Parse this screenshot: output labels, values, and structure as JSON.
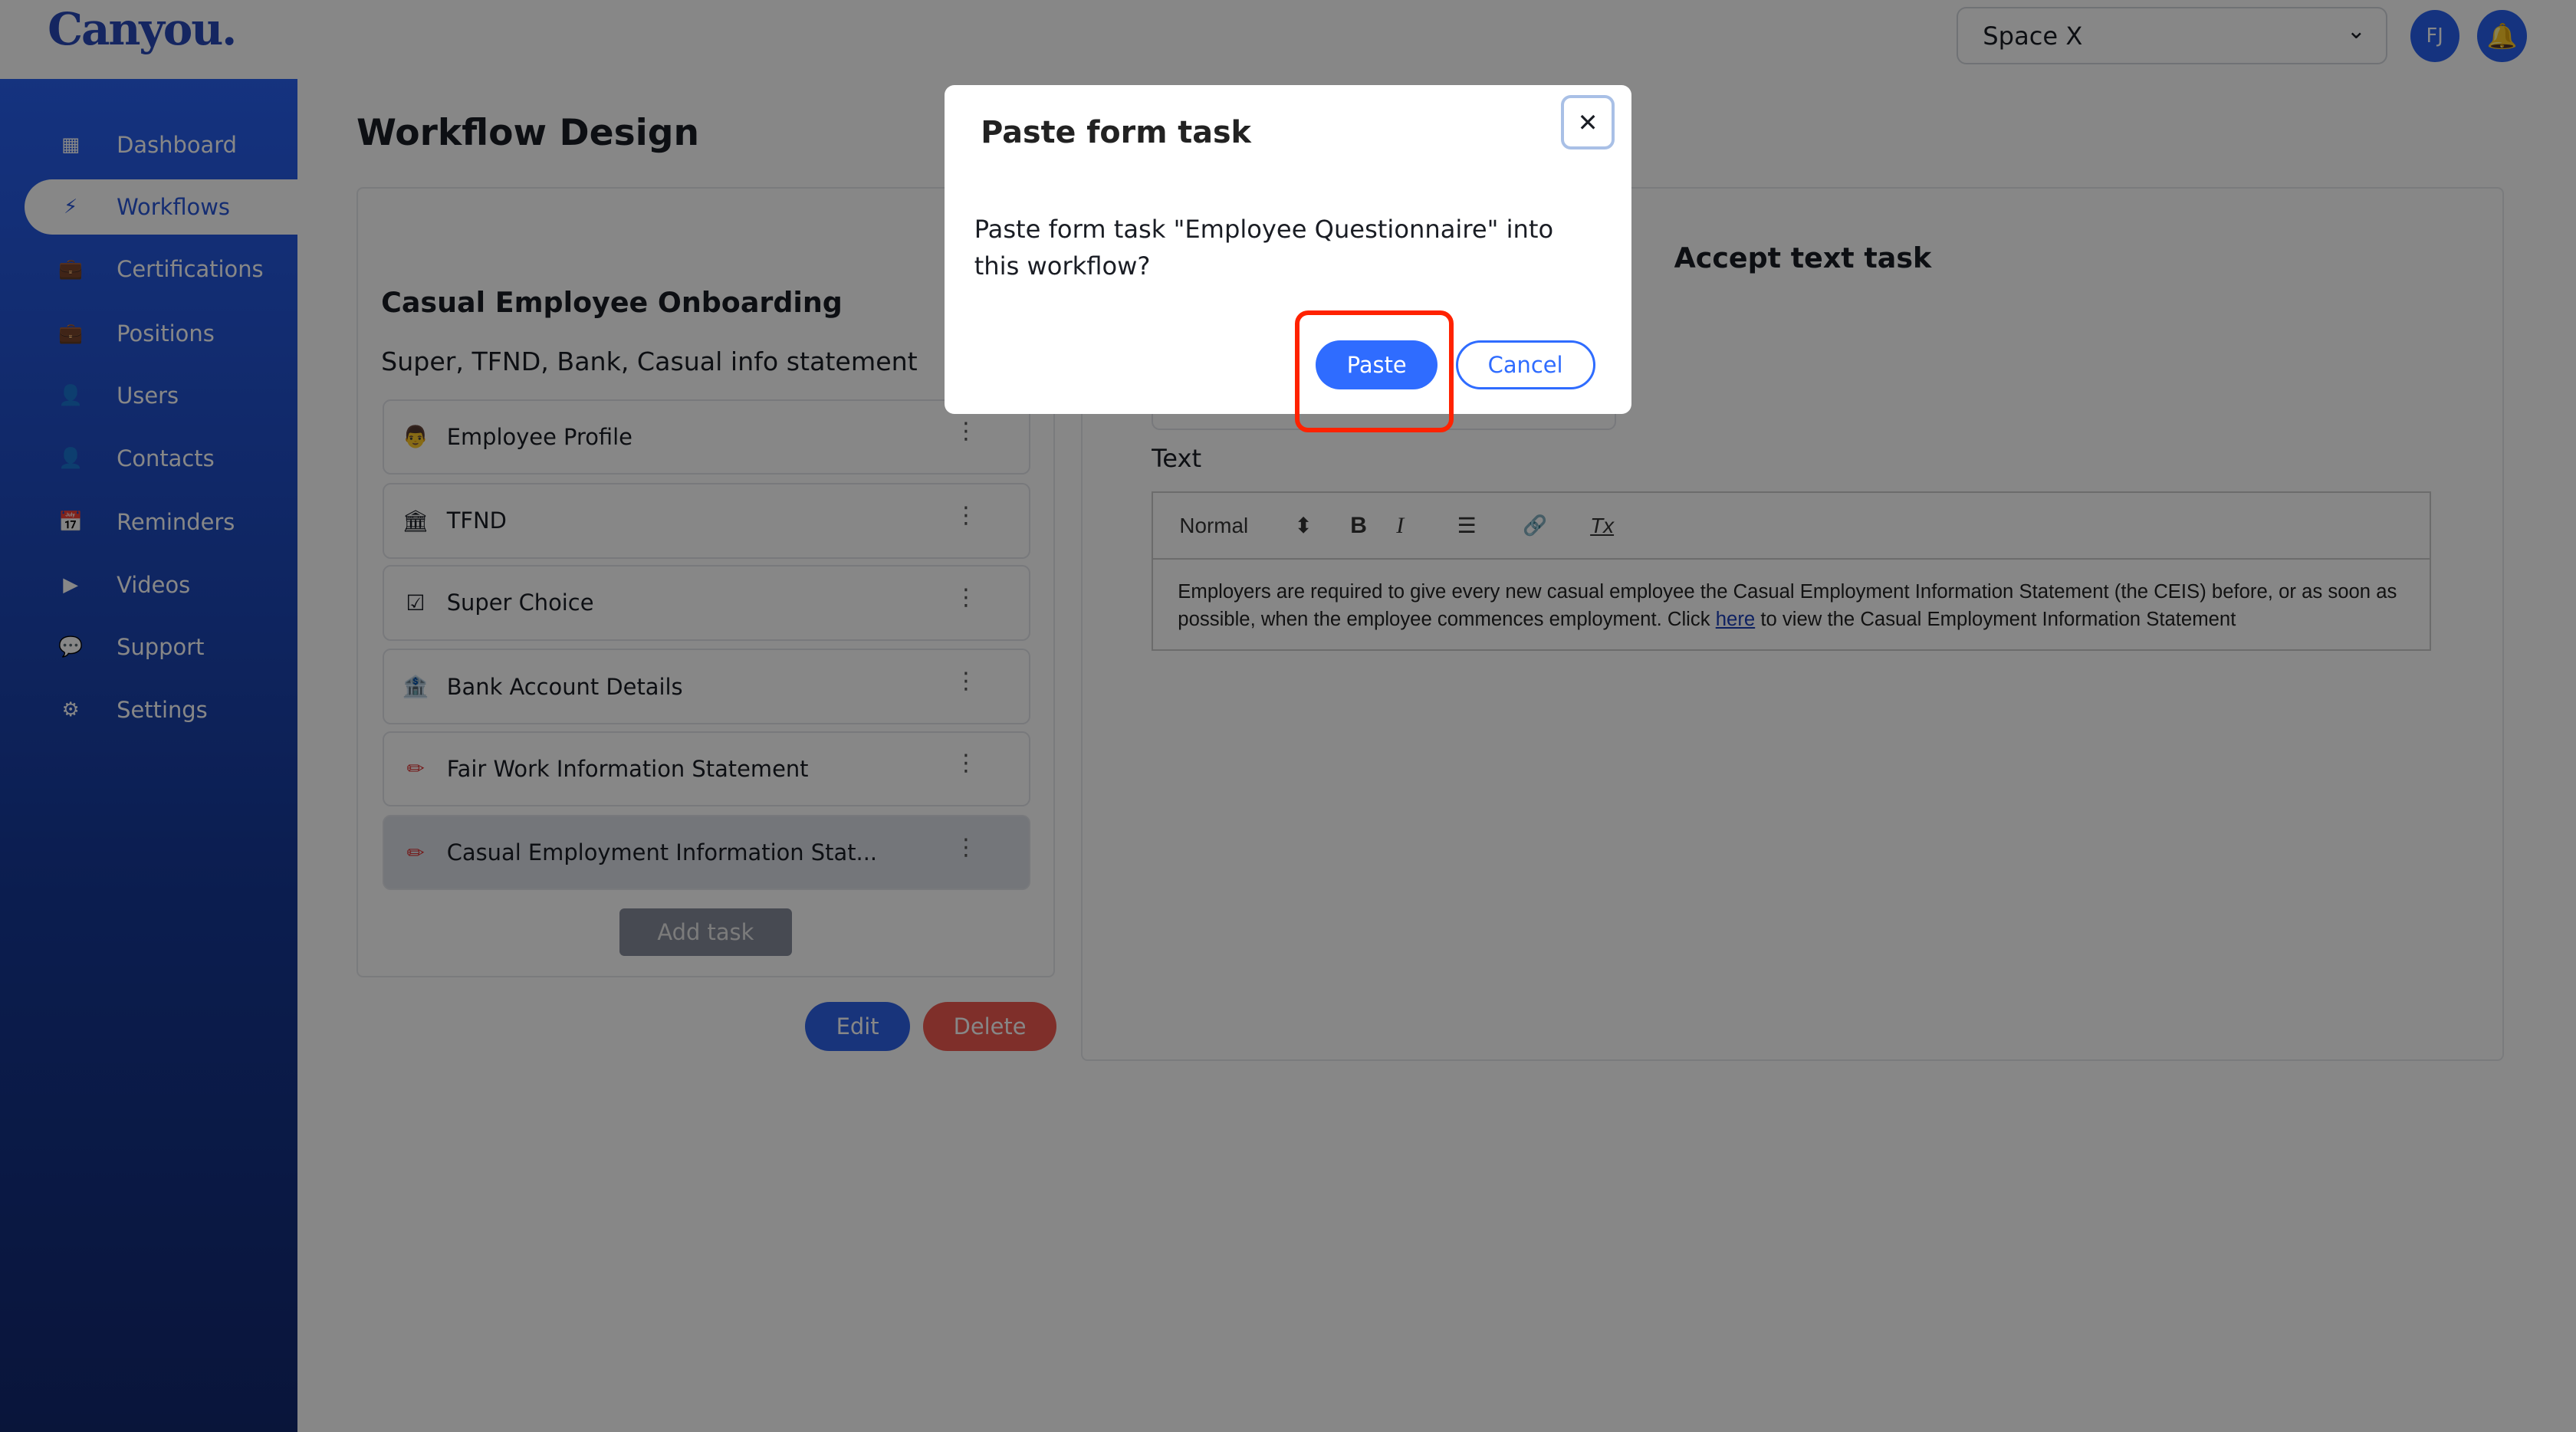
{
  "header": {
    "logo": "Canyou.",
    "space": "Space X",
    "avatar": "FJ"
  },
  "sidebar": {
    "items": [
      {
        "label": "Dashboard",
        "icon": "▦"
      },
      {
        "label": "Workflows",
        "icon": "⚡"
      },
      {
        "label": "Certifications",
        "icon": "💼"
      },
      {
        "label": "Positions",
        "icon": "💼"
      },
      {
        "label": "Users",
        "icon": "👤"
      },
      {
        "label": "Contacts",
        "icon": "👤"
      },
      {
        "label": "Reminders",
        "icon": "📅"
      },
      {
        "label": "Videos",
        "icon": "▶"
      },
      {
        "label": "Support",
        "icon": "💬"
      },
      {
        "label": "Settings",
        "icon": "⚙"
      }
    ]
  },
  "page": {
    "title": "Workflow Design"
  },
  "workflow": {
    "name": "Casual Employee Onboarding",
    "description": "Super, TFND, Bank, Casual info statement",
    "tasks": [
      {
        "label": "Employee Profile",
        "icon": "👨"
      },
      {
        "label": "TFND",
        "icon": "🏛"
      },
      {
        "label": "Super Choice",
        "icon": "☑"
      },
      {
        "label": "Bank Account Details",
        "icon": "🏦"
      },
      {
        "label": "Fair Work Information Statement",
        "icon": "✏"
      },
      {
        "label": "Casual Employment Information Stat...",
        "icon": "✏"
      }
    ],
    "add_task": "Add task",
    "edit": "Edit",
    "delete": "Delete"
  },
  "task_detail": {
    "title": "Accept text task",
    "text_label": "Text",
    "toolbar": {
      "format": "Normal",
      "bold": "B",
      "italic": "I",
      "list": "☰",
      "link": "🔗",
      "clear": "Tx"
    },
    "content_before": "Employers are required to give every new casual employee the Casual Employment Information Statement (the CEIS) before, or as soon as possible, when the employee commences employment. Click ",
    "link_text": "here",
    "content_after": " to view the Casual Employment Information Statement"
  },
  "modal": {
    "title": "Paste form task",
    "message": "Paste form task \"Employee Questionnaire\" into this workflow?",
    "paste": "Paste",
    "cancel": "Cancel",
    "close": "✕"
  },
  "colors": {
    "primary": "#2f6cff",
    "danger": "#f05a50",
    "highlight": "#ff2200",
    "sidebar": "#2860f0"
  }
}
